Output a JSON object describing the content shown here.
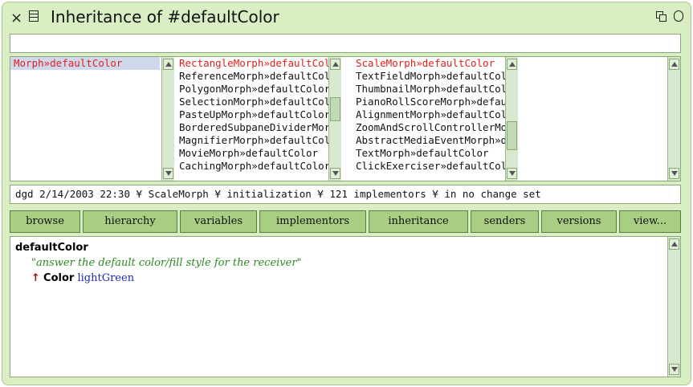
{
  "window": {
    "title": "Inheritance of #defaultColor"
  },
  "search": {
    "value": ""
  },
  "panes": {
    "col1": [
      "Morph»defaultColor"
    ],
    "col2": [
      "RectangleMorph»defaultColor",
      "ReferenceMorph»defaultColor",
      "PolygonMorph»defaultColor",
      "SelectionMorph»defaultColor",
      "PasteUpMorph»defaultColor",
      "BorderedSubpaneDividerMorph»defaultColor",
      "MagnifierMorph»defaultColor",
      "MovieMorph»defaultColor",
      "CachingMorph»defaultColor"
    ],
    "col3": [
      "ScaleMorph»defaultColor",
      "TextFieldMorph»defaultColor",
      "ThumbnailMorph»defaultColor",
      "PianoRollScoreMorph»defaultColor",
      "AlignmentMorph»defaultColor",
      "ZoomAndScrollControllerMorph»defaultColor",
      "AbstractMediaEventMorph»defaultColor",
      "TextMorph»defaultColor",
      "ClickExerciser»defaultColor"
    ]
  },
  "status": "dgd 2/14/2003 22:30 ¥ ScaleMorph ¥ initialization ¥ 121 implementors ¥ in no change set",
  "buttons": [
    "browse",
    "hierarchy",
    "variables",
    "implementors",
    "inheritance",
    "senders",
    "versions",
    "view..."
  ],
  "code": {
    "selector": "defaultColor",
    "comment": "\"answer the default color/fill style for the receiver\"",
    "caret": "↑",
    "class_name": "Color",
    "message": "lightGreen"
  }
}
